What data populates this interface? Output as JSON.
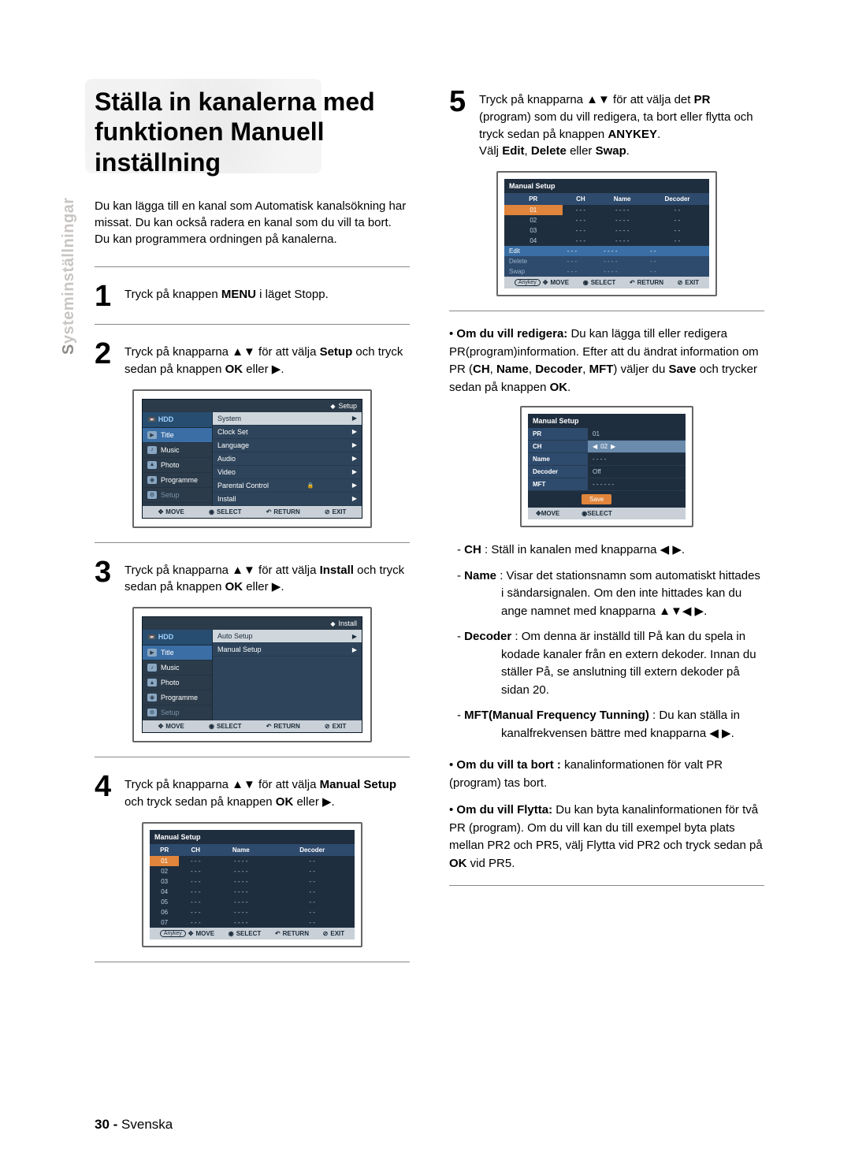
{
  "sideTab": {
    "prefix": "S",
    "rest": "ysteminställningar"
  },
  "heading": "Ställa in kanalerna med funktionen Manuell inställning",
  "intro": "Du kan lägga till en kanal som Automatisk kanalsökning har missat. Du kan också radera en kanal som du vill ta bort. Du kan programmera ordningen på kanalerna.",
  "steps": {
    "s1": {
      "num": "1",
      "t1": "Tryck på knappen ",
      "b1": "MENU",
      "t2": " i läget Stopp."
    },
    "s2": {
      "num": "2",
      "t1": "Tryck på knapparna ▲▼ för att välja ",
      "b1": "Setup",
      "t2": "  och tryck sedan på knappen ",
      "b2": "OK",
      "t3": " eller ▶."
    },
    "s3": {
      "num": "3",
      "t1": "Tryck på knapparna ▲▼ för att välja ",
      "b1": "Install",
      "t2": "  och tryck sedan på knappen ",
      "b2": "OK",
      "t3": " eller ▶."
    },
    "s4": {
      "num": "4",
      "t1": "Tryck på knapparna ▲▼ för att välja ",
      "b1": "Manual Setup",
      "t2": " och tryck sedan på knappen ",
      "b2": "OK",
      "t3": " eller ▶."
    },
    "s5": {
      "num": "5",
      "t1": "Tryck på knapparna ▲▼ för att välja det ",
      "b1": "PR",
      "t2": " (program) som du vill redigera, ta bort eller flytta och tryck sedan på knappen ",
      "b2": "ANYKEY",
      "t3": ".",
      "t4": "Välj ",
      "b3": "Edit",
      "t5": ", ",
      "b4": "Delete",
      "t6": " eller  ",
      "b5": "Swap",
      "t7": "."
    }
  },
  "osd_setup": {
    "crumb": "Setup",
    "side": {
      "hdr": "HDD",
      "items": [
        {
          "lbl": "Title",
          "sel": true
        },
        {
          "lbl": "Music"
        },
        {
          "lbl": "Photo"
        },
        {
          "lbl": "Programme"
        },
        {
          "lbl": "Setup",
          "dim": true
        }
      ]
    },
    "main": [
      {
        "lbl": "System",
        "hl": true
      },
      {
        "lbl": "Clock Set"
      },
      {
        "lbl": "Language"
      },
      {
        "lbl": "Audio"
      },
      {
        "lbl": "Video"
      },
      {
        "lbl": "Parental Control",
        "lock": true
      },
      {
        "lbl": "Install"
      }
    ],
    "foot": {
      "move": "MOVE",
      "select": "SELECT",
      "return": "RETURN",
      "exit": "EXIT"
    }
  },
  "osd_install": {
    "crumb": "Install",
    "side": {
      "hdr": "HDD",
      "items": [
        {
          "lbl": "Title",
          "sel": true
        },
        {
          "lbl": "Music"
        },
        {
          "lbl": "Photo"
        },
        {
          "lbl": "Programme"
        },
        {
          "lbl": "Setup",
          "dim": true
        }
      ]
    },
    "main": [
      {
        "lbl": "Auto Setup",
        "hl": true
      },
      {
        "lbl": "Manual Setup"
      }
    ],
    "foot": {
      "move": "MOVE",
      "select": "SELECT",
      "return": "RETURN",
      "exit": "EXIT"
    }
  },
  "ms_list": {
    "title": "Manual Setup",
    "cols": [
      "PR",
      "CH",
      "Name",
      "Decoder"
    ],
    "rows": [
      {
        "pr": "01",
        "ch": "- - -",
        "name": "- - - -",
        "dec": "- -",
        "sel": true
      },
      {
        "pr": "02",
        "ch": "- - -",
        "name": "- - - -",
        "dec": "- -"
      },
      {
        "pr": "03",
        "ch": "- - -",
        "name": "- - - -",
        "dec": "- -"
      },
      {
        "pr": "04",
        "ch": "- - -",
        "name": "- - - -",
        "dec": "- -"
      },
      {
        "pr": "05",
        "ch": "- - -",
        "name": "- - - -",
        "dec": "- -"
      },
      {
        "pr": "06",
        "ch": "- - -",
        "name": "- - - -",
        "dec": "- -"
      },
      {
        "pr": "07",
        "ch": "- - -",
        "name": "- - - -",
        "dec": "- -"
      }
    ],
    "foot": {
      "anykey": "Anykey",
      "move": "MOVE",
      "select": "SELECT",
      "return": "RETURN",
      "exit": "EXIT"
    }
  },
  "ms_menu": {
    "title": "Manual Setup",
    "cols": [
      "PR",
      "CH",
      "Name",
      "Decoder"
    ],
    "rows": [
      {
        "pr": "01",
        "ch": "- - -",
        "name": "- - - -",
        "dec": "- -",
        "sel": true
      },
      {
        "pr": "02",
        "ch": "- - -",
        "name": "- - - -",
        "dec": "- -"
      },
      {
        "pr": "03",
        "ch": "- - -",
        "name": "- - - -",
        "dec": "- -"
      },
      {
        "pr": "04",
        "ch": "- - -",
        "name": "- - - -",
        "dec": "- -"
      }
    ],
    "opts": [
      {
        "lbl": "Edit",
        "sel": true
      },
      {
        "lbl": "Delete"
      },
      {
        "lbl": "Swap"
      }
    ],
    "extra": [
      {
        "ch": "- - -",
        "name": "- - - -",
        "dec": "- -"
      },
      {
        "ch": "- - -",
        "name": "- - - -",
        "dec": "- -"
      },
      {
        "ch": "- - -",
        "name": "- - - -",
        "dec": "- -"
      }
    ],
    "foot": {
      "anykey": "Anykey",
      "move": "MOVE",
      "select": "SELECT",
      "return": "RETURN",
      "exit": "EXIT"
    }
  },
  "ms_edit": {
    "title": "Manual Setup",
    "rows": [
      {
        "k": "PR",
        "v": "01"
      },
      {
        "k": "CH",
        "v": "02",
        "hl": true,
        "arrows": true
      },
      {
        "k": "Name",
        "v": "- - - -"
      },
      {
        "k": "Decoder",
        "v": "Off"
      },
      {
        "k": "MFT",
        "v": "- - -   - - -"
      }
    ],
    "save": "Save",
    "foot": {
      "move": "MOVE",
      "select": "SELECT"
    }
  },
  "rightBullets": {
    "edit": {
      "lead": "• ",
      "b": "Om du vill redigera:",
      "t1": " Du kan lägga till eller redigera PR(program)information. Efter att du ändrat information om PR (",
      "b2": "CH",
      "c1": ", ",
      "b3": "Name",
      "c2": ", ",
      "b4": "Decoder",
      "c3": ", ",
      "b5": "MFT",
      "t2": ") väljer du ",
      "b6": "Save",
      "t3": " och trycker sedan på knappen ",
      "b7": "OK",
      "t4": "."
    },
    "defs": {
      "ch": {
        "lab": "- ",
        "b": "CH",
        "t": " : Ställ in kanalen med knapparna ◀ ▶."
      },
      "name": {
        "lab": "- ",
        "b": "Name",
        "t": " : Visar det stationsnamn som automatiskt hittades i sändarsignalen. Om den inte hittades kan du ange namnet med knapparna ▲▼◀ ▶."
      },
      "dec": {
        "lab": "- ",
        "b": "Decoder",
        "t": " : Om denna är inställd till På kan du spela in kodade kanaler från en extern dekoder. Innan du ställer På, se anslutning till extern dekoder på sidan 20."
      },
      "mft": {
        "lab": "- ",
        "b": "MFT(Manual Frequency Tunning)",
        "t": " : Du kan ställa in kanalfrekvensen bättre med knapparna ◀ ▶."
      }
    },
    "del": {
      "lead": "• ",
      "b": "Om du vill ta bort :",
      "t": " kanalinformationen för valt PR (program) tas bort."
    },
    "swap": {
      "lead": "• ",
      "b": "Om du vill Flytta:",
      "t1": "  Du kan byta kanalinformationen för två PR (program). Om du vill kan du till exempel byta plats mellan PR2 och PR5, välj Flytta vid PR2 och tryck sedan på ",
      "b2": "OK",
      "t2": " vid PR5."
    }
  },
  "footer": {
    "num": "30 -",
    "lang": "Svenska"
  }
}
